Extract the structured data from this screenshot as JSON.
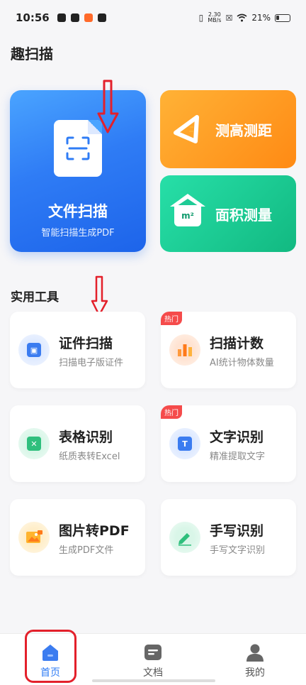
{
  "status_bar": {
    "time": "10:56",
    "net_speed_value": "2.30",
    "net_speed_unit": "MB/s",
    "battery": "21%"
  },
  "app": {
    "title": "趣扫描"
  },
  "featured": {
    "scan": {
      "title": "文件扫描",
      "subtitle": "智能扫描生成PDF"
    },
    "measure": {
      "title": "测高测距"
    },
    "area": {
      "title": "面积测量",
      "icon_text": "m²"
    }
  },
  "tools_section": {
    "title": "实用工具"
  },
  "tools": [
    {
      "title": "证件扫描",
      "subtitle": "扫描电子版证件",
      "hot": ""
    },
    {
      "title": "扫描计数",
      "subtitle": "AI统计物体数量",
      "hot": "热门"
    },
    {
      "title": "表格识别",
      "subtitle": "纸质表转Excel",
      "hot": ""
    },
    {
      "title": "文字识别",
      "subtitle": "精准提取文字",
      "hot": "热门"
    },
    {
      "title": "图片转PDF",
      "subtitle": "生成PDF文件",
      "hot": ""
    },
    {
      "title": "手写识别",
      "subtitle": "手写文字识别",
      "hot": ""
    }
  ],
  "nav": {
    "home": "首页",
    "docs": "文档",
    "mine": "我的"
  },
  "colors": {
    "accent": "#2f7cf5",
    "active_nav": "#2f7cf5",
    "hot_badge": "#f54b4b",
    "annotation_red": "#e3202b"
  }
}
